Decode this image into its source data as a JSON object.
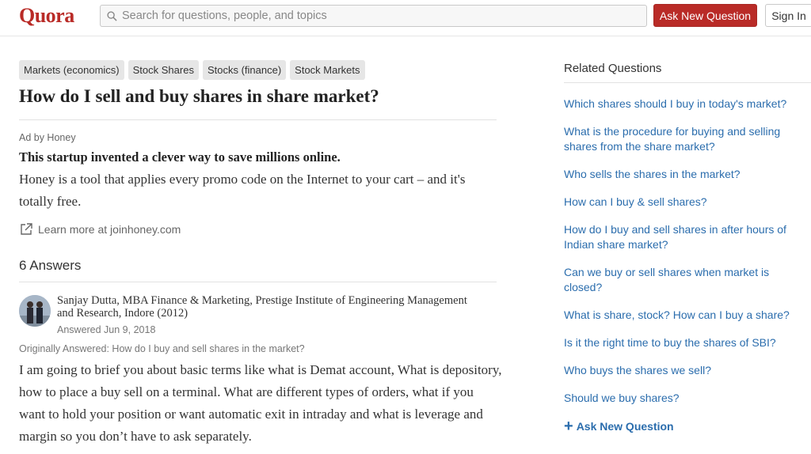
{
  "header": {
    "logo": "Quora",
    "search_placeholder": "Search for questions, people, and topics",
    "ask_button": "Ask New Question",
    "signin_button": "Sign In"
  },
  "question": {
    "topics": [
      "Markets (economics)",
      "Stock Shares",
      "Stocks (finance)",
      "Stock Markets"
    ],
    "title": "How do I sell and buy shares in share market?"
  },
  "ad": {
    "by": "Ad by Honey",
    "headline": "This startup invented a clever way to save millions online.",
    "body": "Honey is a tool that applies every promo code on the Internet to your cart – and it's totally free.",
    "link": "Learn more at joinhoney.com"
  },
  "answers": {
    "count_label": "6 Answers",
    "first": {
      "author": "Sanjay Dutta, MBA Finance & Marketing, Prestige Institute of Engineering Management and Research, Indore (2012)",
      "date": "Answered Jun 9, 2018",
      "originally": "Originally Answered: How do I buy and sell shares in the market?",
      "body": "I am going to brief you about basic terms like what is Demat account, What is depository, how to place a buy sell on a terminal. What are different types of orders, what if you want to hold your position or want automatic exit in intraday and what is leverage and margin so you don’t have to ask separately."
    }
  },
  "sidebar": {
    "title": "Related Questions",
    "items": [
      "Which shares should I buy in today's market?",
      "What is the procedure for buying and selling shares from the share market?",
      "Who sells the shares in the market?",
      "How can I buy & sell shares?",
      "How do I buy and sell shares in after hours of Indian share market?",
      "Can we  buy or sell shares when market is closed?",
      "What is share, stock? How can I buy a share?",
      "Is it the right time to buy the shares of SBI?",
      "Who buys the shares we sell?",
      "Should we buy shares?"
    ],
    "ask_link": "Ask New Question"
  },
  "colors": {
    "brand": "#b92b27",
    "link": "#2b6dad",
    "topic_bg": "#e6e6e6"
  }
}
